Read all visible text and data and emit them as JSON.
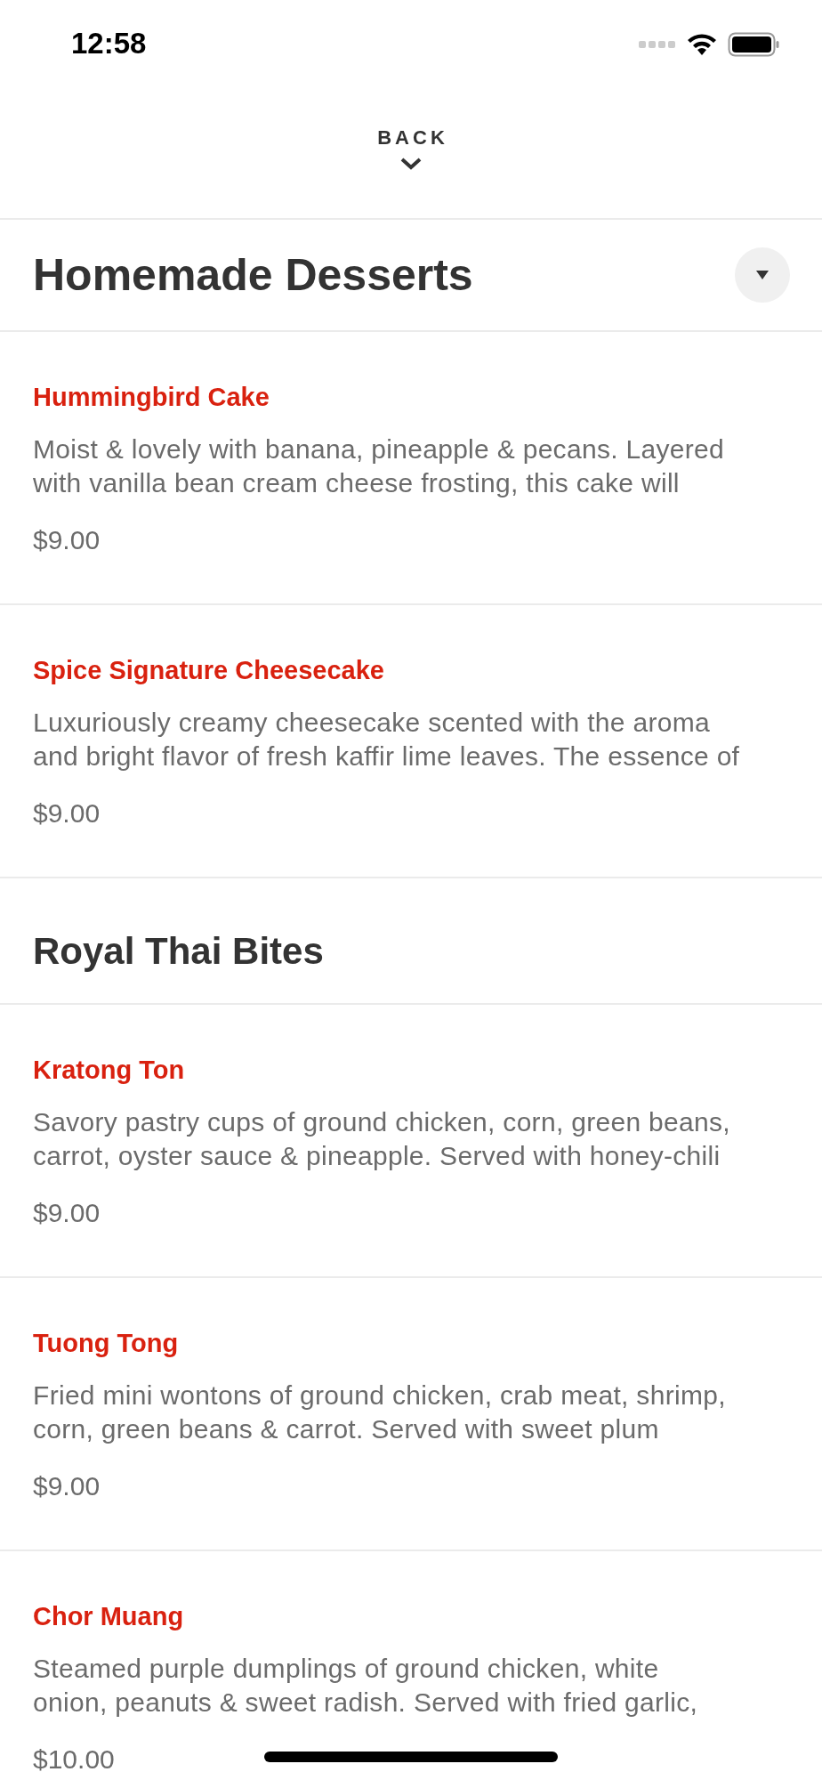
{
  "status_bar": {
    "time": "12:58"
  },
  "header": {
    "back_label": "BACK"
  },
  "sections": [
    {
      "title": "Homemade Desserts",
      "has_toggle": true,
      "items": [
        {
          "name": "Hummingbird Cake",
          "description_lines": [
            "Moist & lovely with banana, pineapple & pecans. Layered",
            "with vanilla bean cream cheese frosting, this cake will"
          ],
          "price": "$9.00"
        },
        {
          "name": "Spice Signature Cheesecake",
          "description_lines": [
            "Luxuriously creamy cheesecake scented with the aroma",
            "and bright flavor of fresh kaffir lime leaves. The essence of"
          ],
          "price": "$9.00"
        }
      ]
    },
    {
      "title": "Royal Thai Bites",
      "has_toggle": false,
      "items": [
        {
          "name": "Kratong Ton",
          "description_lines": [
            "Savory pastry cups of ground chicken, corn, green beans,",
            "carrot, oyster sauce & pineapple. Served with honey-chili"
          ],
          "price": "$9.00"
        },
        {
          "name": "Tuong Tong",
          "description_lines": [
            "Fried mini wontons of ground chicken, crab meat, shrimp,",
            "corn, green beans & carrot. Served with sweet plum"
          ],
          "price": "$9.00"
        },
        {
          "name": "Chor Muang",
          "description_lines": [
            "Steamed purple dumplings of ground chicken, white",
            "onion, peanuts & sweet radish. Served with fried garlic,"
          ],
          "price": "$10.00"
        }
      ]
    }
  ]
}
